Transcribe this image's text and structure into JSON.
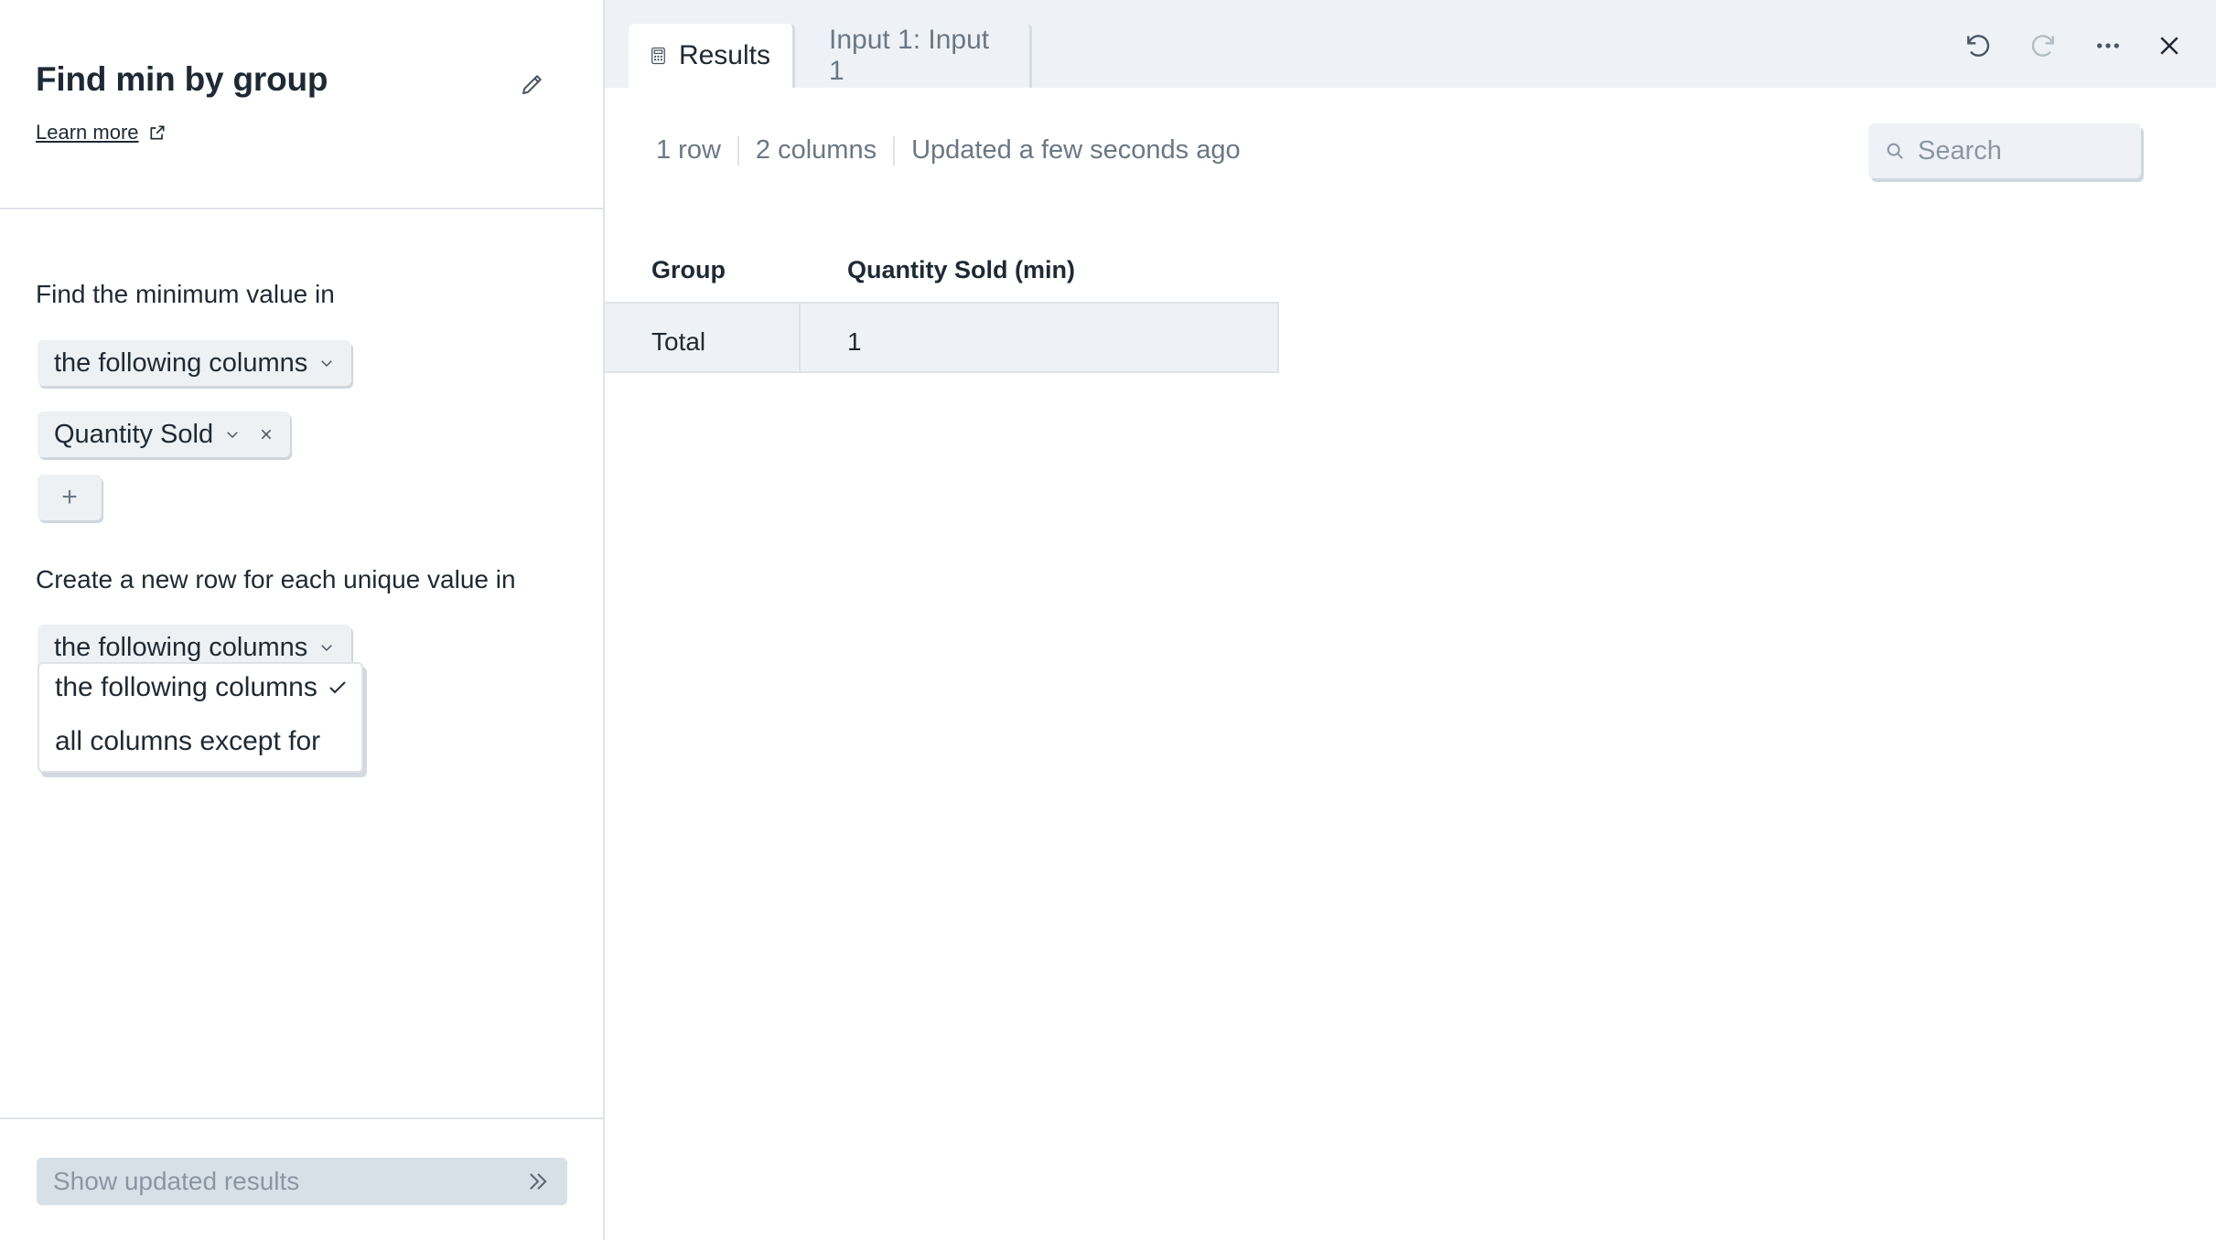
{
  "left_panel": {
    "title": "Find min by group",
    "learn_more": "Learn more",
    "section1_label": "Find the minimum value in",
    "section1_select": "the following columns",
    "column_chip": "Quantity Sold",
    "add_button": "+",
    "section2_label": "Create a new row for each unique value in",
    "section2_select": "the following columns",
    "dropdown_options": [
      {
        "label": "the following columns",
        "selected": true
      },
      {
        "label": "all columns except for",
        "selected": false
      }
    ],
    "footer_button": "Show updated results"
  },
  "right_panel": {
    "tabs": [
      {
        "label": "Results",
        "active": true,
        "icon": "calculator-icon"
      },
      {
        "label": "Input 1: Input 1",
        "active": false
      }
    ],
    "toolbar_icons": [
      "undo-icon",
      "redo-icon",
      "more-icon",
      "close-icon"
    ],
    "meta": {
      "rows": "1 row",
      "columns": "2 columns",
      "updated": "Updated a few seconds ago"
    },
    "search": {
      "placeholder": "Search",
      "value": ""
    },
    "table": {
      "headers": [
        "Group",
        "Quantity Sold (min)"
      ],
      "rows": [
        [
          "Total",
          "1"
        ]
      ]
    }
  },
  "colors": {
    "text": "#1f2933",
    "muted": "#6b7784",
    "panel_bg": "#eef2f6",
    "border": "#dfe3e8"
  }
}
